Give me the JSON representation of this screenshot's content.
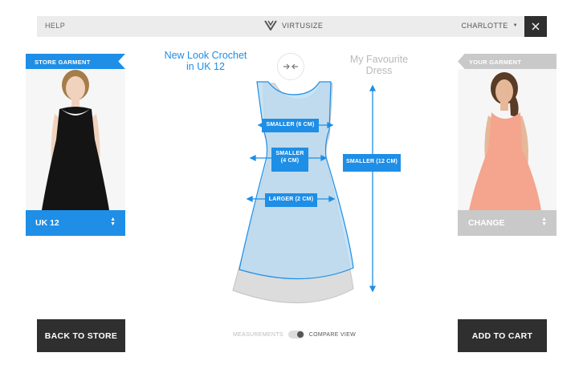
{
  "topbar": {
    "help": "HELP",
    "brand": "VIRTUSIZE",
    "user": "CHARLOTTE",
    "caret_icon": "caret-down-icon",
    "close_icon": "close-icon"
  },
  "store_garment": {
    "flag": "STORE GARMENT",
    "size": "UK 12",
    "title": [
      "New Look Crochet",
      "in UK 12"
    ]
  },
  "your_garment": {
    "flag": "YOUR GARMENT",
    "select": "CHANGE",
    "title": [
      "My Favourite",
      "Dress"
    ]
  },
  "measurements": {
    "chest": "SMALLER (6 CM)",
    "waist": [
      "SMALLER",
      "(4 CM)"
    ],
    "hip": "LARGER (2 CM)",
    "length": "SMALLER (12 CM)"
  },
  "footer": {
    "back": "BACK TO STORE",
    "add": "ADD TO CART",
    "measurements_label": "MEASUREMENTS",
    "compare_label": "COMPARE VIEW"
  },
  "colors": {
    "accent": "#1e8ee6",
    "dark": "#2f2f2f",
    "muted": "#c9c9c9"
  }
}
